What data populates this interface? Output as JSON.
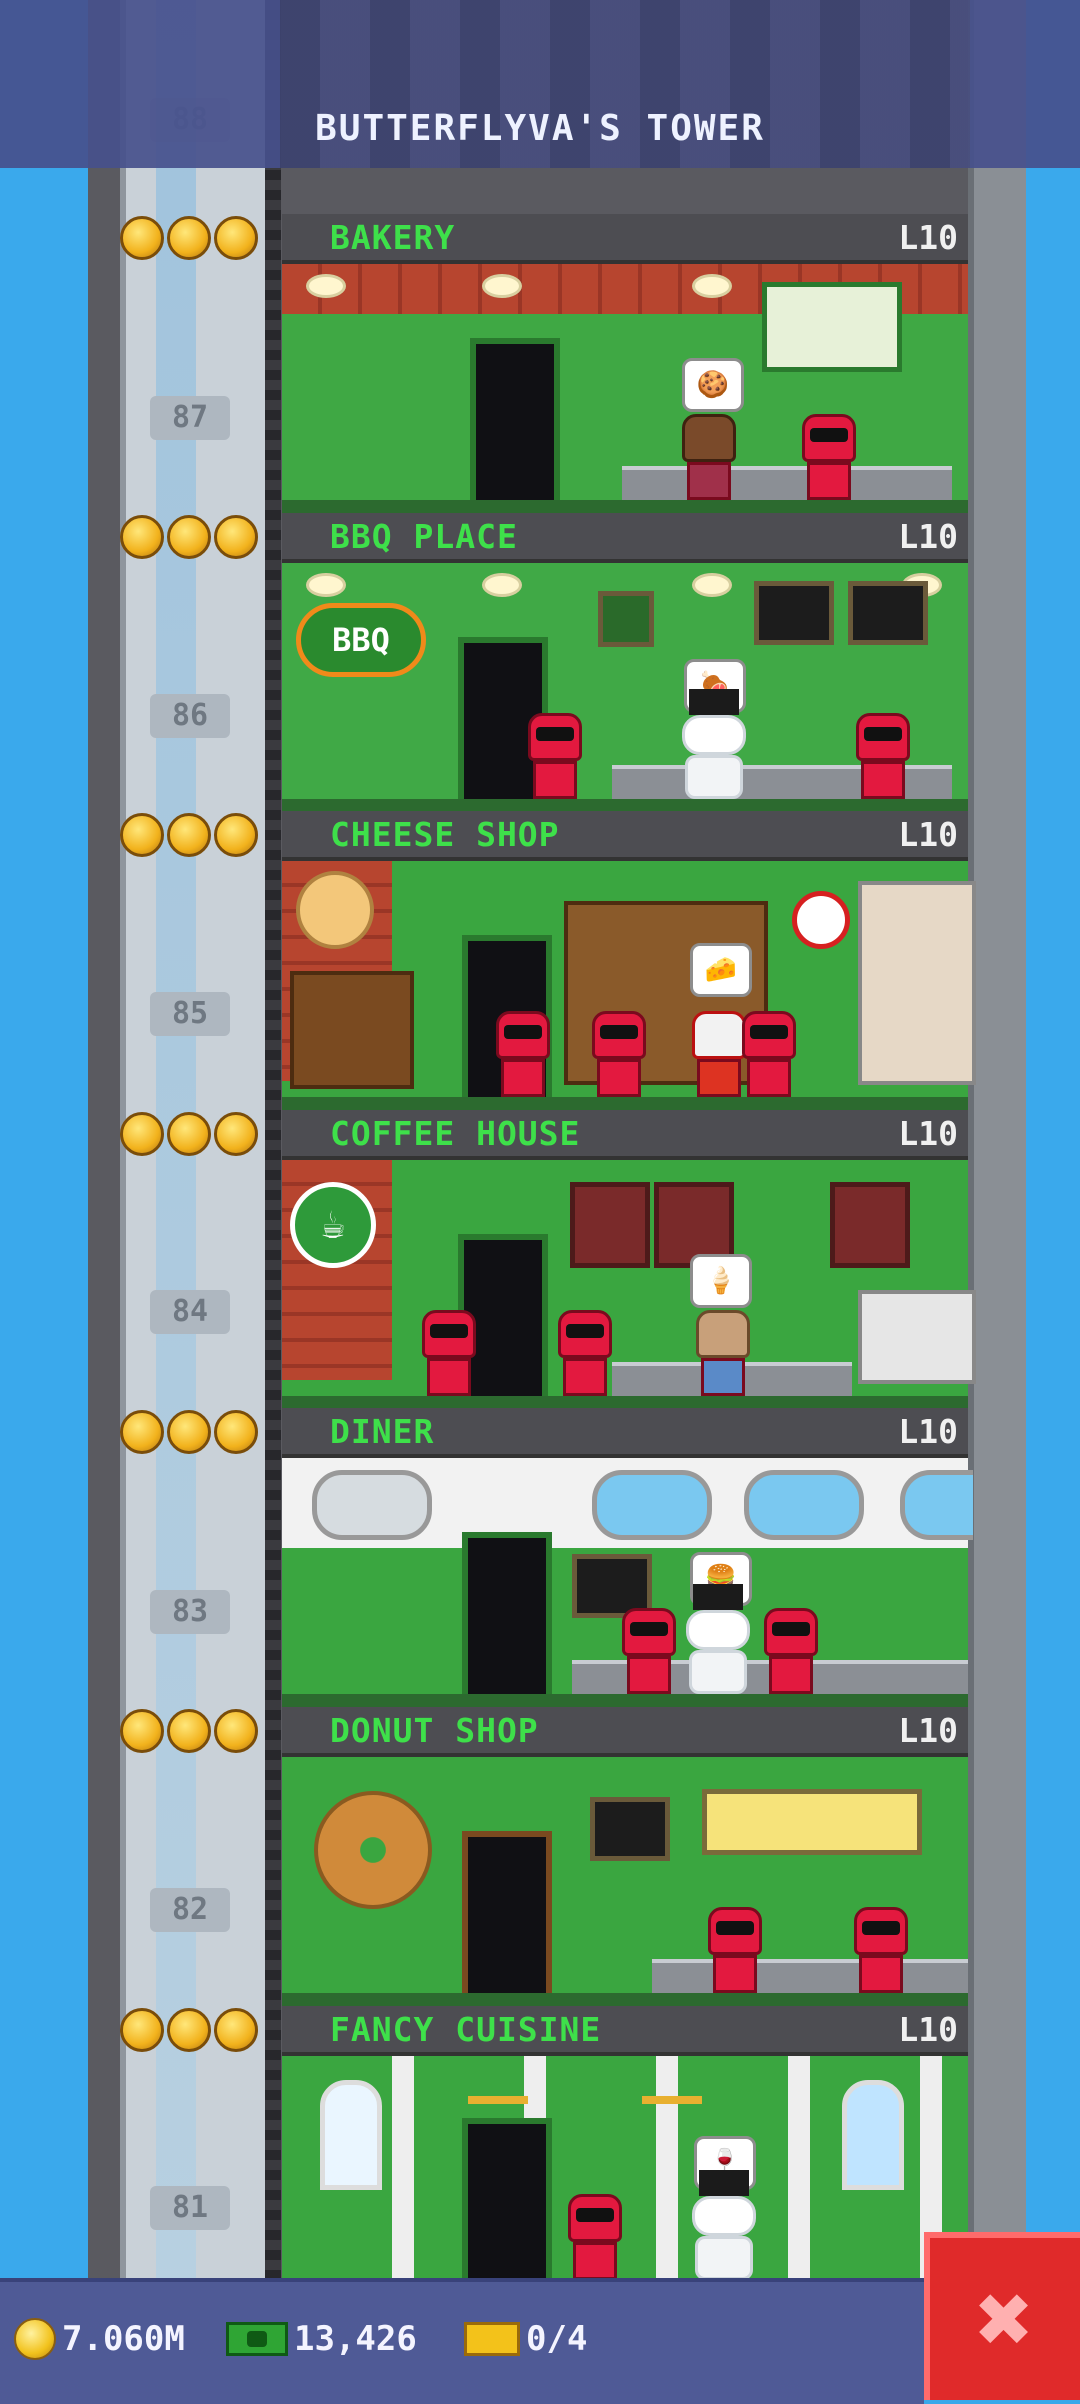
{
  "header": {
    "title": "BUTTERFLYVA'S TOWER"
  },
  "floors": [
    {
      "name": "BAKERY",
      "level": "L10",
      "number": "87",
      "bubble": "🍪"
    },
    {
      "name": "BBQ PLACE",
      "level": "L10",
      "number": "86",
      "bubble": "🍖"
    },
    {
      "name": "CHEESE SHOP",
      "level": "L10",
      "number": "85",
      "bubble": "🧀"
    },
    {
      "name": "COFFEE HOUSE",
      "level": "L10",
      "number": "84",
      "bubble": "🍦"
    },
    {
      "name": "DINER",
      "level": "L10",
      "number": "83",
      "bubble": "🍔"
    },
    {
      "name": "DONUT SHOP",
      "level": "L10",
      "number": "82",
      "bubble": "🍩"
    },
    {
      "name": "FANCY CUISINE",
      "level": "L10",
      "number": "81",
      "bubble": "🍷"
    }
  ],
  "top_floor_number": "88",
  "bbq_sign": "BBQ",
  "stats": {
    "coins": "7.060M",
    "bux": "13,426",
    "tickets": "0/4"
  },
  "icons": {
    "coin": "coin-icon",
    "bux": "cash-icon",
    "ticket": "ticket-icon",
    "close": "close-icon",
    "star": "star-icon"
  },
  "colors": {
    "floor_name": "#3ee04a",
    "room_green": "#3aa640",
    "close": "#e02a2a",
    "sky": "#3aa9ec"
  }
}
